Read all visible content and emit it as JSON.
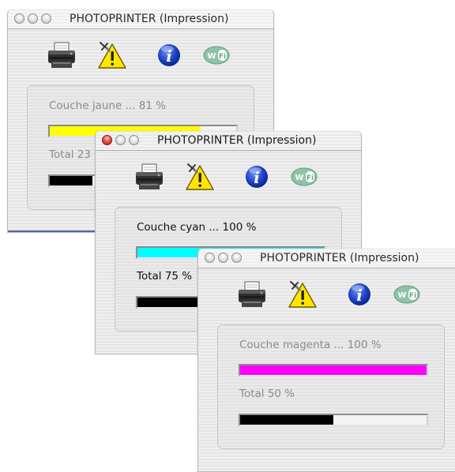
{
  "windows": [
    {
      "title": "PHOTOPRINTER (Impression)",
      "active": false,
      "layer_label": "Couche jaune ...",
      "layer_percent_text": "81 %",
      "layer_progress": 0.81,
      "layer_color": "#ffff00",
      "total_label": "Total 23",
      "total_progress": 0.23,
      "total_color": "#000000",
      "icons": [
        "printer-icon",
        "warning-icon",
        "info-icon",
        "wifi-icon"
      ]
    },
    {
      "title": "PHOTOPRINTER (Impression)",
      "active": true,
      "layer_label": "Couche cyan ...",
      "layer_percent_text": "100 %",
      "layer_progress": 1.0,
      "layer_color": "#00ffff",
      "total_label": "Total 75 %",
      "total_progress": 0.75,
      "total_color": "#000000",
      "icons": [
        "printer-icon",
        "warning-icon",
        "info-icon",
        "wifi-icon"
      ]
    },
    {
      "title": "PHOTOPRINTER (Impression)",
      "active": false,
      "layer_label": "Couche magenta ...",
      "layer_percent_text": "100 %",
      "layer_progress": 1.0,
      "layer_color": "#ff00ff",
      "total_label": "Total 50 %",
      "total_progress": 0.5,
      "total_color": "#000000",
      "icons": [
        "printer-icon",
        "warning-icon",
        "info-icon",
        "wifi-icon"
      ]
    }
  ],
  "icon_labels": {
    "wifi": "Wi Fi"
  }
}
